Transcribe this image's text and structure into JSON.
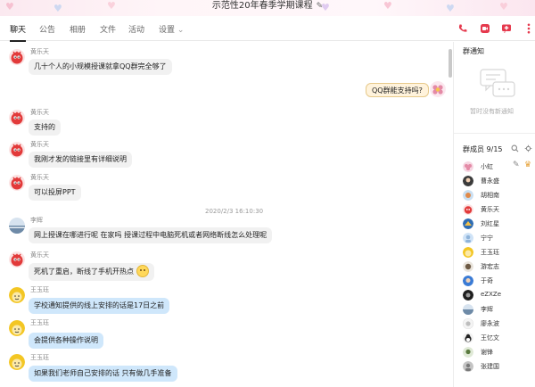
{
  "window": {
    "title": "示范性20年春季学期课程"
  },
  "tabs": [
    {
      "label": "聊天"
    },
    {
      "label": "公告"
    },
    {
      "label": "相册"
    },
    {
      "label": "文件"
    },
    {
      "label": "活动"
    },
    {
      "label": "设置"
    }
  ],
  "toolbar_icons": [
    "phone-icon",
    "video-icon",
    "screen-share-icon",
    "more-icon"
  ],
  "colors": {
    "accent_red": "#e5394d",
    "bubble_grey": "#f1f1f1",
    "bubble_blue": "#cfe7fb",
    "title_bg": "#fbe9f0"
  },
  "chat": {
    "timestamp": "2020/2/3 16:10:30",
    "messages": [
      {
        "sender": "黄乐天",
        "text": "几十个人的小规模授课就拿QQ群完全够了",
        "side": "left"
      },
      {
        "sender": "",
        "text": "QQ群能支持吗?",
        "side": "right"
      },
      {
        "sender": "黄乐天",
        "text": "支持的",
        "side": "left"
      },
      {
        "sender": "黄乐天",
        "text": "我刚才发的链接里有详细说明",
        "side": "left"
      },
      {
        "sender": "黄乐天",
        "text": "可以投屏PPT",
        "side": "left"
      },
      {
        "sender": "李辉",
        "text": "网上授课在哪进行呢 在家吗 授课过程中电脑死机或者网络断线怎么处理呢",
        "side": "left"
      },
      {
        "sender": "黄乐天",
        "text": "死机了重启，断线了手机开热点",
        "side": "left"
      },
      {
        "sender": "王玉珏",
        "text": "学校通知提供的线上安排的话是17日之前",
        "side": "left"
      },
      {
        "sender": "王玉珏",
        "text": "会提供各种操作说明",
        "side": "left"
      },
      {
        "sender": "王玉珏",
        "text": "如果我们老师自己安排的话 只有做几手准备",
        "side": "left"
      }
    ]
  },
  "right_panel": {
    "notice_title": "群通知",
    "notice_empty": "暂时没有新通知",
    "members_title": "群成员 9/15",
    "members": [
      {
        "name": "小虹"
      },
      {
        "name": "曹永盛"
      },
      {
        "name": "胡相南"
      },
      {
        "name": "黄乐天"
      },
      {
        "name": "刘红星"
      },
      {
        "name": "宁宁"
      },
      {
        "name": "王玉珏"
      },
      {
        "name": "游宏志"
      },
      {
        "name": "于奇"
      },
      {
        "name": "eZXZe"
      },
      {
        "name": "李辉"
      },
      {
        "name": "廖永波"
      },
      {
        "name": "王忆文"
      },
      {
        "name": "谢锋"
      },
      {
        "name": "张建国"
      }
    ]
  }
}
